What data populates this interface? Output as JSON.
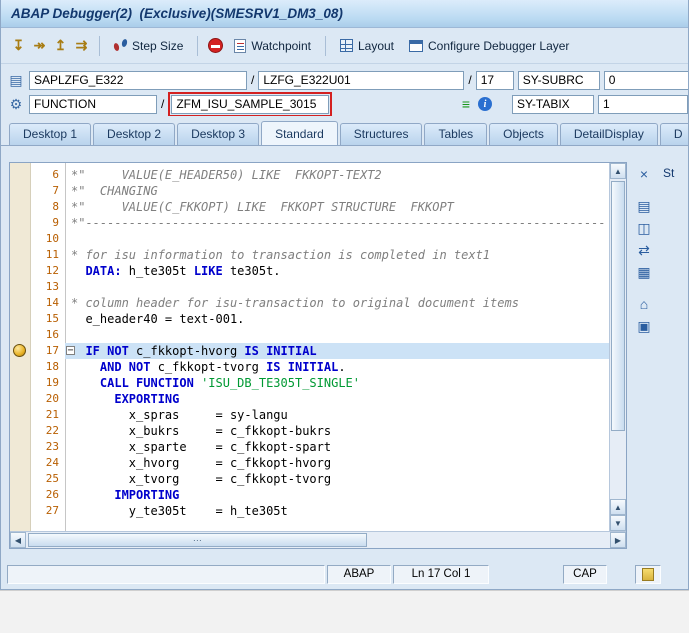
{
  "window": {
    "title": "ABAP Debugger(2)  (Exclusive)(SMESRV1_DM3_08)"
  },
  "toolbar": {
    "step_icons": [
      {
        "name": "step-into-icon",
        "glyph": "↧"
      },
      {
        "name": "step-over-icon",
        "glyph": "↠"
      },
      {
        "name": "return-icon",
        "glyph": "↥"
      },
      {
        "name": "continue-icon",
        "glyph": "⇉"
      }
    ],
    "step_size_label": "Step Size",
    "watchpoint_label": "Watchpoint",
    "layout_label": "Layout",
    "configure_label": "Configure Debugger Layer"
  },
  "fields": {
    "slash": "/",
    "program_icon": "▤",
    "event_icon": "⚙",
    "green_icon": "≡",
    "info_icon": "i",
    "program": "SAPLZFG_E322",
    "include": "LZFG_E322U01",
    "line_no": "17",
    "sy_subrc_label": "SY-SUBRC",
    "sy_subrc_value": "0",
    "event_type": "FUNCTION",
    "event_name": "ZFM_ISU_SAMPLE_3015",
    "sy_tabix_label": "SY-TABIX",
    "sy_tabix_value": "1"
  },
  "tabs": [
    {
      "label": "Desktop 1",
      "active": false
    },
    {
      "label": "Desktop 2",
      "active": false
    },
    {
      "label": "Desktop 3",
      "active": false
    },
    {
      "label": "Standard",
      "active": true
    },
    {
      "label": "Structures",
      "active": false
    },
    {
      "label": "Tables",
      "active": false
    },
    {
      "label": "Objects",
      "active": false
    },
    {
      "label": "DetailDisplay",
      "active": false
    },
    {
      "label": "D",
      "active": false
    }
  ],
  "side_panel": {
    "header": "St"
  },
  "editor": {
    "fold_glyph": "−",
    "scrollbar": {
      "up": "▲",
      "down": "▼",
      "left": "◀",
      "right": "▶",
      "grip": "⋯"
    },
    "icon_strip": [
      {
        "name": "close-icon",
        "glyph": "×"
      },
      {
        "name": "display-change-icon",
        "glyph": "▤",
        "gap": true
      },
      {
        "name": "services-icon",
        "glyph": "◫"
      },
      {
        "name": "swap-panels-icon",
        "glyph": "⇄"
      },
      {
        "name": "split-screen-icon",
        "glyph": "▦"
      },
      {
        "name": "home-icon",
        "glyph": "⌂",
        "gap": true
      },
      {
        "name": "goto-statement-icon",
        "glyph": "▣"
      }
    ],
    "lines": [
      {
        "n": "6",
        "seg": [
          {
            "t": "*\"     VALUE(E_HEADER50) LIKE  FKKOPT-TEXT2",
            "c": "cmt"
          }
        ]
      },
      {
        "n": "7",
        "seg": [
          {
            "t": "*\"  CHANGING",
            "c": "cmt"
          }
        ]
      },
      {
        "n": "8",
        "seg": [
          {
            "t": "*\"     VALUE(C_FKKOPT) LIKE  FKKOPT STRUCTURE  FKKOPT",
            "c": "cmt"
          }
        ]
      },
      {
        "n": "9",
        "seg": [
          {
            "t": "*\"------------------------------------------------------------------------",
            "c": "cmt"
          }
        ]
      },
      {
        "n": "10",
        "seg": []
      },
      {
        "n": "11",
        "seg": [
          {
            "t": "* for isu information to transaction is completed in text1",
            "c": "cmt"
          }
        ]
      },
      {
        "n": "12",
        "seg": [
          {
            "t": "  ",
            "c": ""
          },
          {
            "t": "DATA:",
            "c": "kw"
          },
          {
            "t": " h_te305t ",
            "c": ""
          },
          {
            "t": "LIKE",
            "c": "kw"
          },
          {
            "t": " te305t.",
            "c": ""
          }
        ]
      },
      {
        "n": "13",
        "seg": []
      },
      {
        "n": "14",
        "seg": [
          {
            "t": "* column header for isu-transaction to original document items",
            "c": "cmt"
          }
        ]
      },
      {
        "n": "15",
        "seg": [
          {
            "t": "  e_header40 = text-001.",
            "c": ""
          }
        ]
      },
      {
        "n": "16",
        "seg": []
      },
      {
        "n": "17",
        "current": true,
        "marker": true,
        "fold": true,
        "seg": [
          {
            "t": "  ",
            "c": ""
          },
          {
            "t": "IF NOT",
            "c": "kw"
          },
          {
            "t": " c_fkkopt-hvorg ",
            "c": ""
          },
          {
            "t": "IS INITIAL",
            "c": "kw"
          }
        ]
      },
      {
        "n": "18",
        "seg": [
          {
            "t": "    ",
            "c": ""
          },
          {
            "t": "AND NOT",
            "c": "kw"
          },
          {
            "t": " c_fkkopt-tvorg ",
            "c": ""
          },
          {
            "t": "IS INITIAL",
            "c": "kw"
          },
          {
            "t": ".",
            "c": ""
          }
        ]
      },
      {
        "n": "19",
        "seg": [
          {
            "t": "    ",
            "c": ""
          },
          {
            "t": "CALL FUNCTION",
            "c": "kw"
          },
          {
            "t": " ",
            "c": ""
          },
          {
            "t": "'ISU_DB_TE305T_SINGLE'",
            "c": "str"
          }
        ]
      },
      {
        "n": "20",
        "seg": [
          {
            "t": "      ",
            "c": ""
          },
          {
            "t": "EXPORTING",
            "c": "kw"
          }
        ]
      },
      {
        "n": "21",
        "seg": [
          {
            "t": "        x_spras     = sy-langu",
            "c": ""
          }
        ]
      },
      {
        "n": "22",
        "seg": [
          {
            "t": "        x_bukrs     = c_fkkopt-bukrs",
            "c": ""
          }
        ]
      },
      {
        "n": "23",
        "seg": [
          {
            "t": "        x_sparte    = c_fkkopt-spart",
            "c": ""
          }
        ]
      },
      {
        "n": "24",
        "seg": [
          {
            "t": "        x_hvorg     = c_fkkopt-hvorg",
            "c": ""
          }
        ]
      },
      {
        "n": "25",
        "seg": [
          {
            "t": "        x_tvorg     = c_fkkopt-tvorg",
            "c": ""
          }
        ]
      },
      {
        "n": "26",
        "seg": [
          {
            "t": "      ",
            "c": ""
          },
          {
            "t": "IMPORTING",
            "c": "kw"
          }
        ]
      },
      {
        "n": "27",
        "seg": [
          {
            "t": "        y_te305t    = h_te305t",
            "c": ""
          }
        ]
      }
    ]
  },
  "statusbar": {
    "language": "ABAP",
    "position": "Ln 17 Col 1",
    "caps": "CAP"
  },
  "colors": {
    "keyword": "#0000cc",
    "comment": "#7f7f7f",
    "string": "#009933",
    "line_number": "#b85e00",
    "current_line_bg": "#cce2f6",
    "annotation": "#d42020"
  }
}
